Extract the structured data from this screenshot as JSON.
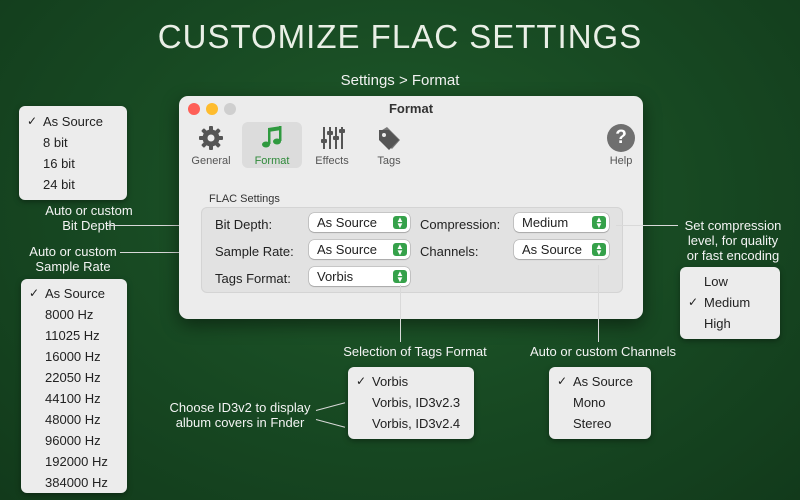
{
  "headline": "CUSTOMIZE FLAC SETTINGS",
  "subhead": "Settings > Format",
  "window": {
    "title": "Format",
    "toolbar": [
      {
        "label": "General",
        "icon": "gear-icon",
        "selected": false
      },
      {
        "label": "Format",
        "icon": "music-note-icon",
        "selected": true
      },
      {
        "label": "Effects",
        "icon": "sliders-icon",
        "selected": false
      },
      {
        "label": "Tags",
        "icon": "tag-icon",
        "selected": false
      },
      {
        "label": "Help",
        "icon": "help-icon",
        "selected": false
      }
    ],
    "help_glyph": "?",
    "group_title": "FLAC Settings",
    "fields": {
      "bit_depth": {
        "label": "Bit Depth:",
        "value": "As Source"
      },
      "sample_rate": {
        "label": "Sample Rate:",
        "value": "As Source"
      },
      "tags_format": {
        "label": "Tags Format:",
        "value": "Vorbis"
      },
      "compression": {
        "label": "Compression:",
        "value": "Medium"
      },
      "channels": {
        "label": "Channels:",
        "value": "As Source"
      }
    }
  },
  "notes": {
    "bit_depth": [
      "Auto or custom",
      "Bit Depth"
    ],
    "sample_rate": [
      "Auto or custom",
      "Sample Rate"
    ],
    "compression": [
      "Set compression",
      "level, for quality",
      "or fast encoding"
    ],
    "tags_format": "Selection of Tags Format",
    "channels": "Auto or custom Channels",
    "id3": [
      "Choose ID3v2 to display",
      "album covers in Fnder"
    ]
  },
  "menus": {
    "bit_depth": {
      "items": [
        "As Source",
        "8 bit",
        "16 bit",
        "24 bit"
      ],
      "checked": "As Source"
    },
    "sample_rate": {
      "items": [
        "As Source",
        "8000 Hz",
        "11025 Hz",
        "16000 Hz",
        "22050 Hz",
        "44100 Hz",
        "48000 Hz",
        "96000 Hz",
        "192000 Hz",
        "384000 Hz"
      ],
      "checked": "As Source"
    },
    "compression": {
      "items": [
        "Low",
        "Medium",
        "High"
      ],
      "checked": "Medium"
    },
    "tags_format": {
      "items": [
        "Vorbis",
        "Vorbis, ID3v2.3",
        "Vorbis, ID3v2.4"
      ],
      "checked": "Vorbis"
    },
    "channels": {
      "items": [
        "As Source",
        "Mono",
        "Stereo"
      ],
      "checked": "As Source"
    }
  },
  "check_glyph": "✓",
  "colors": {
    "accent": "#35a14a",
    "background": "#174822"
  }
}
